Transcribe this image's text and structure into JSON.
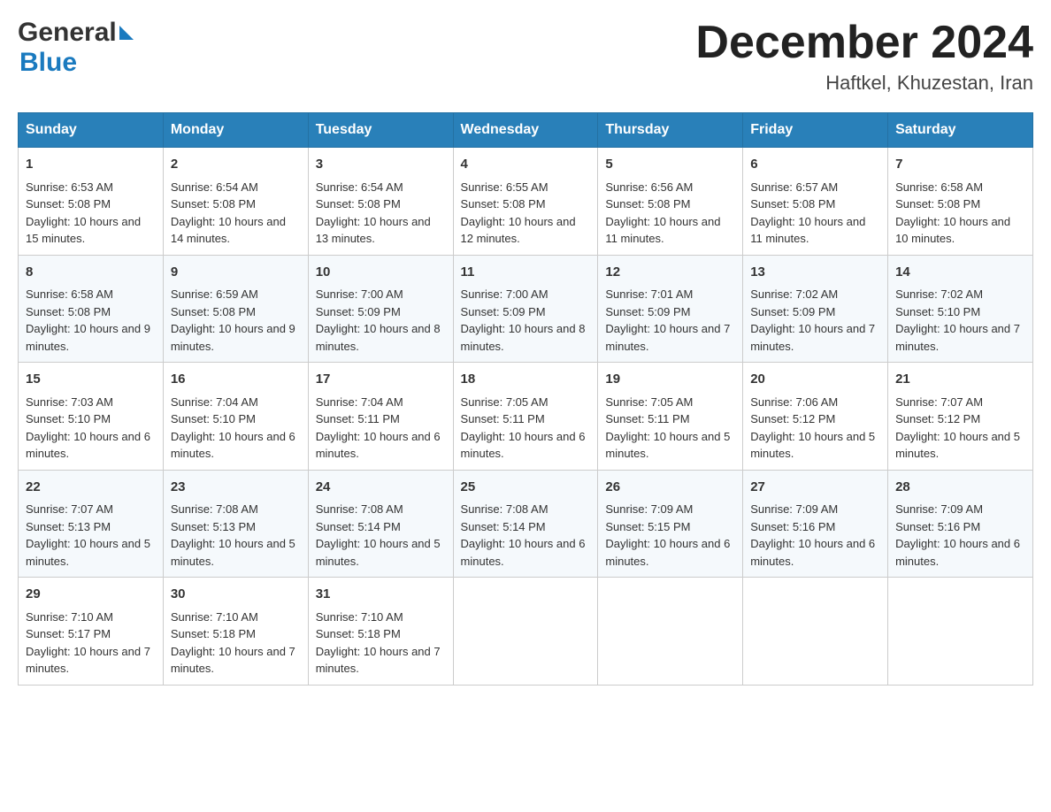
{
  "header": {
    "logo_general": "General",
    "logo_blue": "Blue",
    "title": "December 2024",
    "location": "Haftkel, Khuzestan, Iran"
  },
  "days_of_week": [
    "Sunday",
    "Monday",
    "Tuesday",
    "Wednesday",
    "Thursday",
    "Friday",
    "Saturday"
  ],
  "weeks": [
    [
      {
        "day": "1",
        "sunrise": "Sunrise: 6:53 AM",
        "sunset": "Sunset: 5:08 PM",
        "daylight": "Daylight: 10 hours and 15 minutes."
      },
      {
        "day": "2",
        "sunrise": "Sunrise: 6:54 AM",
        "sunset": "Sunset: 5:08 PM",
        "daylight": "Daylight: 10 hours and 14 minutes."
      },
      {
        "day": "3",
        "sunrise": "Sunrise: 6:54 AM",
        "sunset": "Sunset: 5:08 PM",
        "daylight": "Daylight: 10 hours and 13 minutes."
      },
      {
        "day": "4",
        "sunrise": "Sunrise: 6:55 AM",
        "sunset": "Sunset: 5:08 PM",
        "daylight": "Daylight: 10 hours and 12 minutes."
      },
      {
        "day": "5",
        "sunrise": "Sunrise: 6:56 AM",
        "sunset": "Sunset: 5:08 PM",
        "daylight": "Daylight: 10 hours and 11 minutes."
      },
      {
        "day": "6",
        "sunrise": "Sunrise: 6:57 AM",
        "sunset": "Sunset: 5:08 PM",
        "daylight": "Daylight: 10 hours and 11 minutes."
      },
      {
        "day": "7",
        "sunrise": "Sunrise: 6:58 AM",
        "sunset": "Sunset: 5:08 PM",
        "daylight": "Daylight: 10 hours and 10 minutes."
      }
    ],
    [
      {
        "day": "8",
        "sunrise": "Sunrise: 6:58 AM",
        "sunset": "Sunset: 5:08 PM",
        "daylight": "Daylight: 10 hours and 9 minutes."
      },
      {
        "day": "9",
        "sunrise": "Sunrise: 6:59 AM",
        "sunset": "Sunset: 5:08 PM",
        "daylight": "Daylight: 10 hours and 9 minutes."
      },
      {
        "day": "10",
        "sunrise": "Sunrise: 7:00 AM",
        "sunset": "Sunset: 5:09 PM",
        "daylight": "Daylight: 10 hours and 8 minutes."
      },
      {
        "day": "11",
        "sunrise": "Sunrise: 7:00 AM",
        "sunset": "Sunset: 5:09 PM",
        "daylight": "Daylight: 10 hours and 8 minutes."
      },
      {
        "day": "12",
        "sunrise": "Sunrise: 7:01 AM",
        "sunset": "Sunset: 5:09 PM",
        "daylight": "Daylight: 10 hours and 7 minutes."
      },
      {
        "day": "13",
        "sunrise": "Sunrise: 7:02 AM",
        "sunset": "Sunset: 5:09 PM",
        "daylight": "Daylight: 10 hours and 7 minutes."
      },
      {
        "day": "14",
        "sunrise": "Sunrise: 7:02 AM",
        "sunset": "Sunset: 5:10 PM",
        "daylight": "Daylight: 10 hours and 7 minutes."
      }
    ],
    [
      {
        "day": "15",
        "sunrise": "Sunrise: 7:03 AM",
        "sunset": "Sunset: 5:10 PM",
        "daylight": "Daylight: 10 hours and 6 minutes."
      },
      {
        "day": "16",
        "sunrise": "Sunrise: 7:04 AM",
        "sunset": "Sunset: 5:10 PM",
        "daylight": "Daylight: 10 hours and 6 minutes."
      },
      {
        "day": "17",
        "sunrise": "Sunrise: 7:04 AM",
        "sunset": "Sunset: 5:11 PM",
        "daylight": "Daylight: 10 hours and 6 minutes."
      },
      {
        "day": "18",
        "sunrise": "Sunrise: 7:05 AM",
        "sunset": "Sunset: 5:11 PM",
        "daylight": "Daylight: 10 hours and 6 minutes."
      },
      {
        "day": "19",
        "sunrise": "Sunrise: 7:05 AM",
        "sunset": "Sunset: 5:11 PM",
        "daylight": "Daylight: 10 hours and 5 minutes."
      },
      {
        "day": "20",
        "sunrise": "Sunrise: 7:06 AM",
        "sunset": "Sunset: 5:12 PM",
        "daylight": "Daylight: 10 hours and 5 minutes."
      },
      {
        "day": "21",
        "sunrise": "Sunrise: 7:07 AM",
        "sunset": "Sunset: 5:12 PM",
        "daylight": "Daylight: 10 hours and 5 minutes."
      }
    ],
    [
      {
        "day": "22",
        "sunrise": "Sunrise: 7:07 AM",
        "sunset": "Sunset: 5:13 PM",
        "daylight": "Daylight: 10 hours and 5 minutes."
      },
      {
        "day": "23",
        "sunrise": "Sunrise: 7:08 AM",
        "sunset": "Sunset: 5:13 PM",
        "daylight": "Daylight: 10 hours and 5 minutes."
      },
      {
        "day": "24",
        "sunrise": "Sunrise: 7:08 AM",
        "sunset": "Sunset: 5:14 PM",
        "daylight": "Daylight: 10 hours and 5 minutes."
      },
      {
        "day": "25",
        "sunrise": "Sunrise: 7:08 AM",
        "sunset": "Sunset: 5:14 PM",
        "daylight": "Daylight: 10 hours and 6 minutes."
      },
      {
        "day": "26",
        "sunrise": "Sunrise: 7:09 AM",
        "sunset": "Sunset: 5:15 PM",
        "daylight": "Daylight: 10 hours and 6 minutes."
      },
      {
        "day": "27",
        "sunrise": "Sunrise: 7:09 AM",
        "sunset": "Sunset: 5:16 PM",
        "daylight": "Daylight: 10 hours and 6 minutes."
      },
      {
        "day": "28",
        "sunrise": "Sunrise: 7:09 AM",
        "sunset": "Sunset: 5:16 PM",
        "daylight": "Daylight: 10 hours and 6 minutes."
      }
    ],
    [
      {
        "day": "29",
        "sunrise": "Sunrise: 7:10 AM",
        "sunset": "Sunset: 5:17 PM",
        "daylight": "Daylight: 10 hours and 7 minutes."
      },
      {
        "day": "30",
        "sunrise": "Sunrise: 7:10 AM",
        "sunset": "Sunset: 5:18 PM",
        "daylight": "Daylight: 10 hours and 7 minutes."
      },
      {
        "day": "31",
        "sunrise": "Sunrise: 7:10 AM",
        "sunset": "Sunset: 5:18 PM",
        "daylight": "Daylight: 10 hours and 7 minutes."
      },
      null,
      null,
      null,
      null
    ]
  ]
}
